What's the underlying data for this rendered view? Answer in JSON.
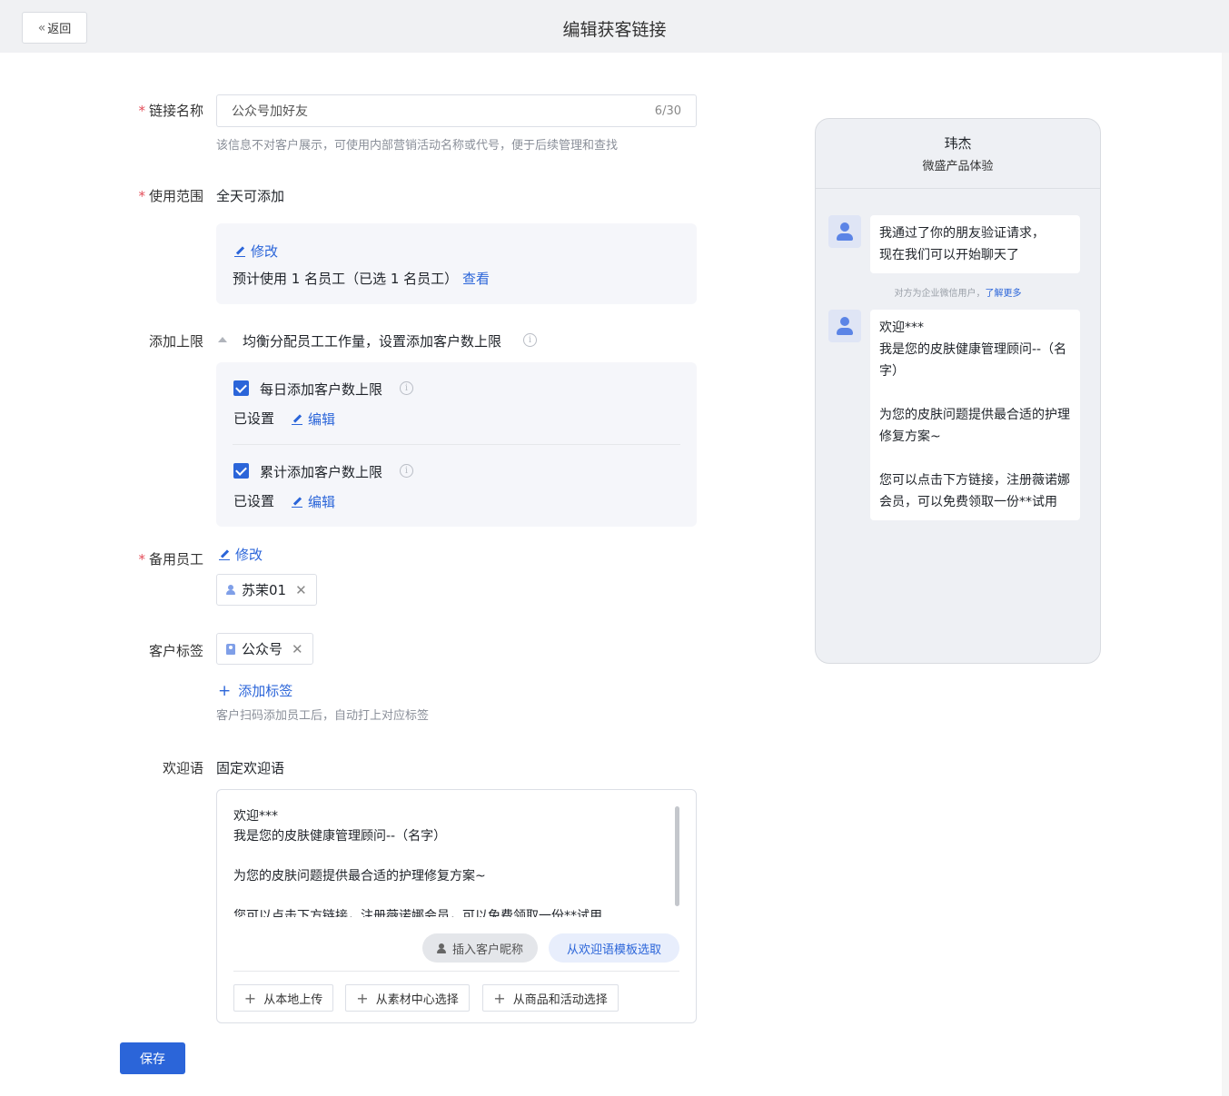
{
  "header": {
    "back_label": "返回",
    "title": "编辑获客链接"
  },
  "form": {
    "link_name": {
      "label": "链接名称",
      "value": "公众号加好友",
      "count": "6/30",
      "hint": "该信息不对客户展示，可使用内部营销活动名称或代号，便于后续管理和查找"
    },
    "scope": {
      "label": "使用范围",
      "value": "全天可添加",
      "modify_label": "修改",
      "summary": "预计使用 1 名员工（已选 1 名员工）",
      "view_label": "查看"
    },
    "limit": {
      "label": "添加上限",
      "description": "均衡分配员工工作量，设置添加客户数上限",
      "daily": {
        "label": "每日添加客户数上限",
        "checked": true,
        "status": "已设置",
        "edit_label": "编辑"
      },
      "total": {
        "label": "累计添加客户数上限",
        "checked": true,
        "status": "已设置",
        "edit_label": "编辑"
      }
    },
    "backup_staff": {
      "label": "备用员工",
      "modify_label": "修改",
      "staff": [
        "苏茉01"
      ]
    },
    "customer_tags": {
      "label": "客户标签",
      "tags": [
        "公众号"
      ],
      "add_label": "添加标签",
      "hint": "客户扫码添加员工后，自动打上对应标签"
    },
    "welcome": {
      "label": "欢迎语",
      "type": "固定欢迎语",
      "text": "欢迎***\n我是您的皮肤健康管理顾问--（名字）\n\n为您的皮肤问题提供最合适的护理修复方案~\n\n您可以点击下方链接，注册薇诺娜会员，可以免费领取一份**试用",
      "insert_nickname_label": "插入客户昵称",
      "template_label": "从欢迎语模板选取",
      "upload_local_label": "从本地上传",
      "material_center_label": "从素材中心选择",
      "product_activity_label": "从商品和活动选择"
    },
    "save_label": "保存"
  },
  "preview": {
    "name": "玮杰",
    "org": "微盛产品体验",
    "message1": "我通过了你的朋友验证请求，\n现在我们可以开始聊天了",
    "system_note": "对方为企业微信用户，",
    "learn_more": "了解更多",
    "message2": "欢迎***\n我是您的皮肤健康管理顾问--（名字）\n\n为您的皮肤问题提供最合适的护理修复方案~\n\n您可以点击下方链接，注册薇诺娜会员，可以免费领取一份**试用"
  },
  "colors": {
    "accent": "#2b65d9",
    "required": "#e34d59"
  }
}
